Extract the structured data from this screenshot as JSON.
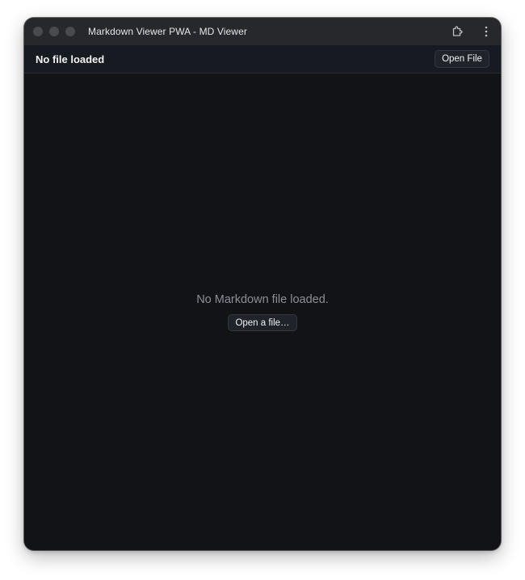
{
  "window": {
    "title": "Markdown Viewer PWA - MD Viewer",
    "traffic_lights": [
      "close-button",
      "minimize-button",
      "zoom-button"
    ],
    "toolbar_icons": [
      "extensions-icon",
      "more-options-icon"
    ]
  },
  "header": {
    "title": "No file loaded",
    "open_file_label": "Open File"
  },
  "main": {
    "empty_message": "No Markdown file loaded.",
    "open_button_label": "Open a file…"
  },
  "colors": {
    "titlebar": "#27282b",
    "appbar": "#171a20",
    "content_bg": "#121317",
    "muted_text": "#8b8f96"
  }
}
